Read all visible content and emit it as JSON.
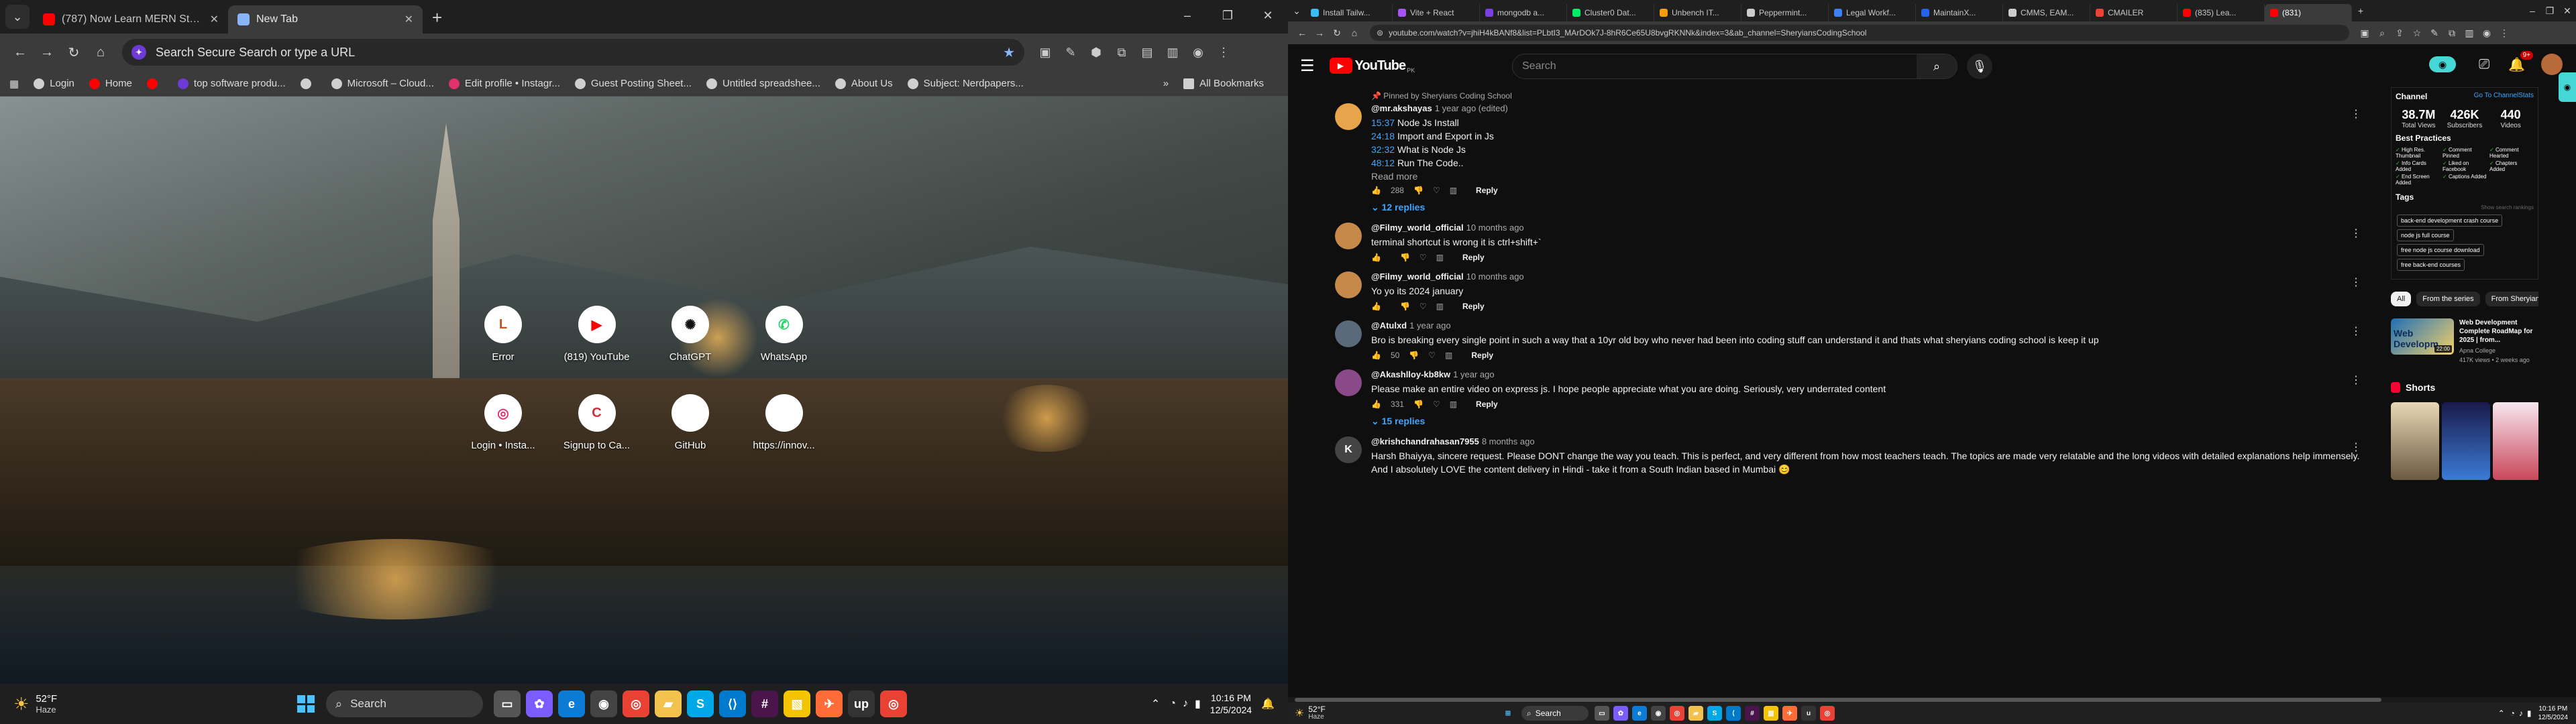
{
  "left": {
    "tabs": [
      {
        "title": "(787) Now Learn MERN Stack w...",
        "color": "#ff0000"
      },
      {
        "title": "New Tab",
        "color": "#8ab4f8"
      }
    ],
    "omnibox_placeholder": "Search Secure Search or type a URL",
    "bookmarks": [
      {
        "label": "Login",
        "color": "#cfcfcf"
      },
      {
        "label": "Home",
        "color": "#ff0000"
      },
      {
        "label": "",
        "color": "#ff0000"
      },
      {
        "label": "top software produ...",
        "color": "#6e3ad6"
      },
      {
        "label": "",
        "color": "#cfcfcf"
      },
      {
        "label": "Microsoft – Cloud...",
        "color": "#cfcfcf"
      },
      {
        "label": "Edit profile • Instagr...",
        "color": "#e1306c"
      },
      {
        "label": "Guest Posting Sheet...",
        "color": "#cfcfcf"
      },
      {
        "label": "Untitled spreadshee...",
        "color": "#cfcfcf"
      },
      {
        "label": "About Us",
        "color": "#cfcfcf"
      },
      {
        "label": "Subject: Nerdpapers...",
        "color": "#cfcfcf"
      }
    ],
    "more_bookmarks": "»",
    "all_bookmarks": "All Bookmarks",
    "shortcuts": [
      {
        "label": "Error",
        "glyph": "L",
        "fg": "#c0541e"
      },
      {
        "label": "(819) YouTube",
        "glyph": "▶",
        "fg": "#ff0000"
      },
      {
        "label": "ChatGPT",
        "glyph": "✺",
        "fg": "#111111"
      },
      {
        "label": "WhatsApp",
        "glyph": "✆",
        "fg": "#25d366"
      },
      {
        "label": "Login • Insta...",
        "glyph": "◎",
        "fg": "#e1306c"
      },
      {
        "label": "Signup to Ca...",
        "glyph": "C",
        "fg": "#d62b3d"
      },
      {
        "label": "GitHub",
        "glyph": "",
        "fg": "#111111"
      },
      {
        "label": "https://innov...",
        "glyph": "",
        "fg": "#111111"
      }
    ],
    "taskbar": {
      "temp": "52°F",
      "condition": "Haze",
      "search": "Search",
      "time": "10:16 PM",
      "date": "12/5/2024"
    }
  },
  "right": {
    "tabs": [
      {
        "title": "Install Tailw...",
        "color": "#38bdf8"
      },
      {
        "title": "Vite + React",
        "color": "#a855f7"
      },
      {
        "title": "mongodb a...",
        "color": "#7b3fe4"
      },
      {
        "title": "Cluster0 Dat...",
        "color": "#00ed64"
      },
      {
        "title": "Unbench IT...",
        "color": "#f59e0b"
      },
      {
        "title": "Peppermint...",
        "color": "#cccccc"
      },
      {
        "title": "Legal Workf...",
        "color": "#3b82f6"
      },
      {
        "title": "MaintainX...",
        "color": "#2563eb"
      },
      {
        "title": "CMMS, EAM...",
        "color": "#cccccc"
      },
      {
        "title": "CMAILER",
        "color": "#ea4335"
      },
      {
        "title": "(835) Lea...",
        "color": "#ff0000"
      },
      {
        "title": "(831)",
        "color": "#ff0000"
      }
    ],
    "url": "youtube.com/watch?v=jhiH4kBANf8&list=PLbtI3_MArDOk7J-8hR6Ce65U8bvgRKNNk&index=3&ab_channel=SheryiansCodingSchool",
    "yt": {
      "logo": "YouTube",
      "country": "PK",
      "search_placeholder": "Search",
      "notif_count": "9+"
    },
    "comments": [
      {
        "pinned": "Pinned by Sheryians Coding School",
        "author": "@mr.akshayas",
        "time": "1 year ago (edited)",
        "lines": [
          {
            "ts": "15:37",
            "text": "Node Js Install"
          },
          {
            "ts": "24:18",
            "text": "Import and Export in Js"
          },
          {
            "ts": "32:32",
            "text": "What is Node Js"
          },
          {
            "ts": "48:12",
            "text": "Run The Code.."
          }
        ],
        "read_more": "Read more",
        "likes": "288",
        "reply": "Reply",
        "replies": "12 replies",
        "avatar_color": "#e8a44a"
      },
      {
        "author": "@Filmy_world_official",
        "time": "10 months ago",
        "text": "terminal shortcut is wrong it is ctrl+shift+`",
        "likes": "",
        "reply": "Reply",
        "avatar_color": "#c58a4a"
      },
      {
        "author": "@Filmy_world_official",
        "time": "10 months ago",
        "text": "Yo yo its 2024 january",
        "likes": "",
        "reply": "Reply",
        "avatar_color": "#c58a4a"
      },
      {
        "author": "@Atulxd",
        "time": "1 year ago",
        "text": "Bro is breaking every single point in such a way that a 10yr old boy who never had been into coding stuff can understand it and thats what sheryians coding school is keep it up",
        "likes": "50",
        "reply": "Reply",
        "avatar_color": "#5a6a7a"
      },
      {
        "author": "@Akashlloy-kb8kw",
        "time": "1 year ago",
        "text": "Please make an entire video on express js. I hope people appreciate what you are doing. Seriously, very underrated content",
        "likes": "331",
        "reply": "Reply",
        "replies": "15 replies",
        "avatar_color": "#8a4a8a"
      },
      {
        "author": "@krishchandrahasan7955",
        "time": "8 months ago",
        "text": "Harsh Bhaiyya, sincere request. Please DONT change the way you teach. This is perfect, and very different from how most teachers teach. The topics are made very relatable and the long videos with detailed explanations help immensely. And I absolutely LOVE the content delivery in Hindi - take it from a South Indian based in Mumbai 😊",
        "likes": "",
        "reply": "",
        "avatar_letter": "K",
        "avatar_color": "#444444"
      }
    ],
    "sidebar": {
      "channel_title": "Channel",
      "channel_link": "Go To ChannelStats",
      "stats": [
        {
          "value": "38.7M",
          "label": "Total Views"
        },
        {
          "value": "426K",
          "label": "Subscribers"
        },
        {
          "value": "440",
          "label": "Videos"
        }
      ],
      "best_practices_title": "Best Practices",
      "best_practices": [
        "High Res. Thumbnail",
        "Comment Pinned",
        "Comment Hearted",
        "Info Cards Added",
        "Liked on Facebook",
        "Chapters Added",
        "End Screen Added",
        "Captions Added"
      ],
      "tags_title": "Tags",
      "tags_sub": "Show search rankings",
      "tags": [
        "back-end development crash course",
        "node js full course",
        "free node js course download",
        "free back-end courses"
      ],
      "chips": [
        "All",
        "From the series",
        "From Sheryians Coding S..."
      ],
      "rec": {
        "title": "Web Development Complete RoadMap for 2025 | from...",
        "channel": "Apna College",
        "meta": "417K views • 2 weeks ago",
        "duration": "22:00",
        "thumb_text": "Web Developm"
      },
      "shorts_title": "Shorts"
    },
    "taskbar": {
      "temp": "52°F",
      "condition": "Haze",
      "search": "Search",
      "time": "10:16 PM",
      "date": "12/5/2024"
    }
  }
}
